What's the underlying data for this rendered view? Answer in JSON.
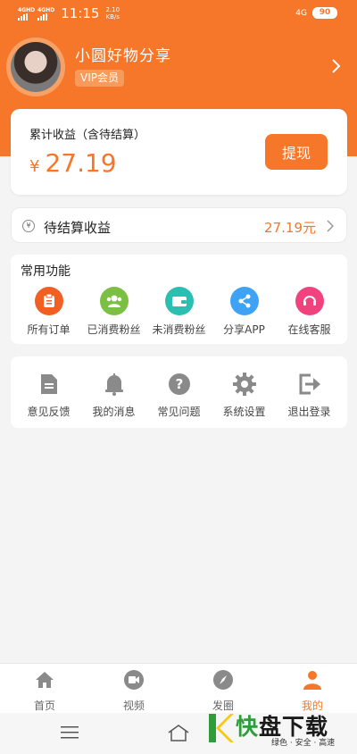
{
  "status_bar": {
    "signal1": "4GHD",
    "signal2": "4GHD",
    "time": "11:15",
    "speed_value": "2.10",
    "speed_unit": "KB/s",
    "network": "4G",
    "battery": "90"
  },
  "profile": {
    "name": "小圆好物分享",
    "badge": "VIP会员"
  },
  "earnings": {
    "label": "累计收益（含待结算）",
    "currency": "¥",
    "amount": "27.19",
    "withdraw_label": "提现"
  },
  "pending": {
    "icon_char": "¥",
    "label": "待结算收益",
    "value": "27.19元"
  },
  "functions": {
    "title": "常用功能",
    "items": [
      {
        "label": "所有订单",
        "icon": "order-icon",
        "color": "#f25f23"
      },
      {
        "label": "已消费粉丝",
        "icon": "fans-icon",
        "color": "#7bc043"
      },
      {
        "label": "未消费粉丝",
        "icon": "wallet-icon",
        "color": "#2bbfb2"
      },
      {
        "label": "分享APP",
        "icon": "share-icon",
        "color": "#3ea3f5"
      },
      {
        "label": "在线客服",
        "icon": "headset-icon",
        "color": "#f0437d"
      }
    ]
  },
  "tools": {
    "items": [
      {
        "label": "意见反馈",
        "icon": "document-icon"
      },
      {
        "label": "我的消息",
        "icon": "bell-icon"
      },
      {
        "label": "常见问题",
        "icon": "question-icon"
      },
      {
        "label": "系统设置",
        "icon": "gear-icon"
      },
      {
        "label": "退出登录",
        "icon": "logout-icon"
      }
    ]
  },
  "bottom_nav": {
    "items": [
      {
        "label": "首页",
        "icon": "home-icon"
      },
      {
        "label": "视频",
        "icon": "video-icon"
      },
      {
        "label": "发圈",
        "icon": "compass-icon"
      },
      {
        "label": "我的",
        "icon": "user-icon"
      }
    ],
    "active_index": 3
  },
  "watermark": {
    "brand_kuai": "快",
    "brand_rest": "盘下载",
    "tagline": "绿色 · 安全 · 高速"
  },
  "colors": {
    "accent": "#f6772a",
    "background": "#f4f4f4",
    "icon_gray": "#8a8a8a"
  }
}
